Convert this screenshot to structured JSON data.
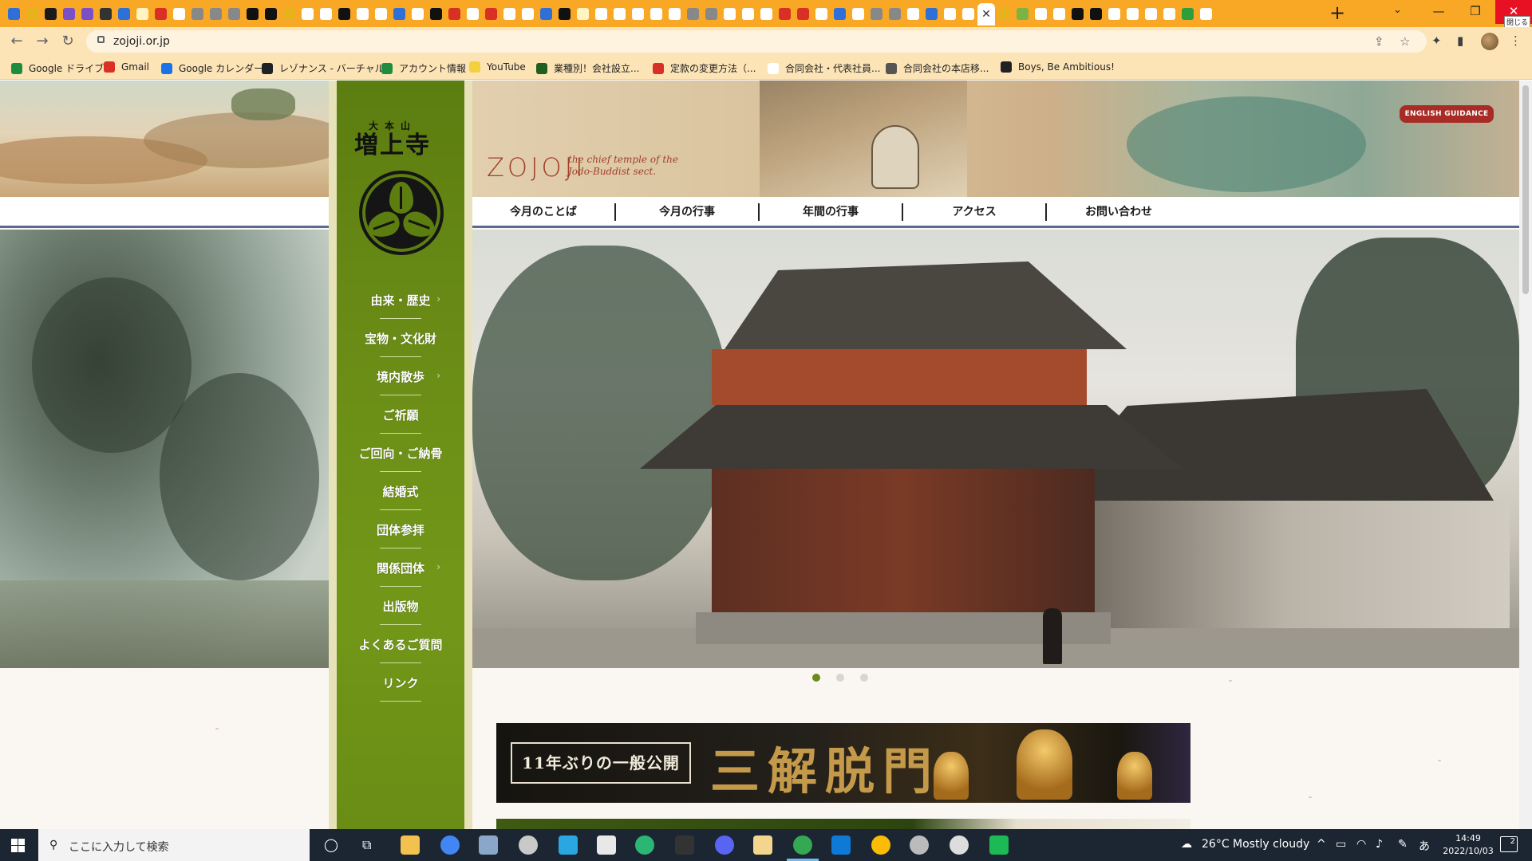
{
  "browser": {
    "active_tab_close": "✕",
    "new_tab": "+",
    "tab_search": "⌄",
    "window": {
      "minimize": "—",
      "maximize": "❐",
      "close": "✕",
      "close_tooltip": "閉じる"
    },
    "nav": {
      "back": "←",
      "forward": "→",
      "reload": "↻"
    },
    "url": "zojoji.or.jp",
    "tab_favicon_colors": [
      "#2e6fd8",
      "#e8b21e",
      "#1b1b1b",
      "#7b4fc8",
      "#7b4fc8",
      "#333333",
      "#2e6fd8",
      "#fff4c2",
      "#d93025",
      "#ffffff",
      "#888888",
      "#888888",
      "#888888",
      "#111111",
      "#111111",
      "#e8b21e",
      "#ffffff",
      "#ffffff",
      "#111111",
      "#ffffff",
      "#ffffff",
      "#2e6fd8",
      "#ffffff",
      "#111111",
      "#d93025",
      "#ffffff",
      "#d93025",
      "#ffffff",
      "#ffffff",
      "#2e6fd8",
      "#111111",
      "#fff4c2",
      "#ffffff",
      "#ffffff",
      "#ffffff",
      "#ffffff",
      "#ffffff",
      "#888888",
      "#888888",
      "#ffffff",
      "#ffffff",
      "#ffffff",
      "#d93025",
      "#d93025",
      "#ffffff",
      "#2e6fd8",
      "#ffffff",
      "#888888",
      "#888888",
      "#ffffff",
      "#2e6fd8",
      "#ffffff",
      "#ffffff"
    ],
    "right_tab_favicon_colors": [
      "#e8b21e",
      "#7cb342",
      "#ffffff",
      "#ffffff",
      "#111111",
      "#111111",
      "#ffffff",
      "#ffffff",
      "#ffffff",
      "#ffffff",
      "#2e9d3a",
      "#ffffff"
    ]
  },
  "bookmarks": [
    {
      "label": "Google ドライブ",
      "color": "#1e8e3e"
    },
    {
      "label": "Gmail",
      "color": "#d93025"
    },
    {
      "label": "Google カレンダー",
      "color": "#1a73e8"
    },
    {
      "label": "レゾナンス - バーチャル...",
      "color": "#202124"
    },
    {
      "label": "アカウント情報",
      "color": "#1e8e3e"
    },
    {
      "label": "YouTube",
      "color": "#f4d03f"
    },
    {
      "label": "業種別！会社設立...",
      "color": "#1e5e1e"
    },
    {
      "label": "定款の変更方法（...",
      "color": "#d93025"
    },
    {
      "label": "合同会社・代表社員...",
      "color": "#ffffff"
    },
    {
      "label": "合同会社の本店移...",
      "color": "#555555"
    },
    {
      "label": "Boys, Be Ambitious!",
      "color": "#202124"
    }
  ],
  "site": {
    "logo_text": "ZOJOJI",
    "logo_sub": "the chief temple of the Jodo-Buddist sect.",
    "english_button": "ENGLISH GUIDANCE",
    "mark_small": "大本山",
    "mark_big": "増上寺",
    "top_nav": [
      "今月のことば",
      "今月の行事",
      "年間の行事",
      "アクセス",
      "お問い合わせ"
    ],
    "side_menu": [
      {
        "label": "由来・歴史",
        "chev": "›"
      },
      {
        "label": "宝物・文化財",
        "chev": ""
      },
      {
        "label": "境内散歩",
        "chev": "›"
      },
      {
        "label": "ご祈願",
        "chev": ""
      },
      {
        "label": "ご回向・ご納骨",
        "chev": "›"
      },
      {
        "label": "結婚式",
        "chev": ""
      },
      {
        "label": "団体参拝",
        "chev": ""
      },
      {
        "label": "関係団体",
        "chev": "›"
      },
      {
        "label": "出版物",
        "chev": ""
      },
      {
        "label": "よくあるご質問",
        "chev": ""
      },
      {
        "label": "リンク",
        "chev": ""
      }
    ],
    "slider_count": 3,
    "slider_active": 1,
    "banner": {
      "tag": "11年ぶりの一般公開",
      "title": "三解脱門"
    }
  },
  "taskbar": {
    "search_placeholder": "ここに入力して検索",
    "weather": "26°C  Mostly cloudy",
    "ime": "あ",
    "time": "14:49",
    "date": "2022/10/03",
    "notifications": "2"
  }
}
